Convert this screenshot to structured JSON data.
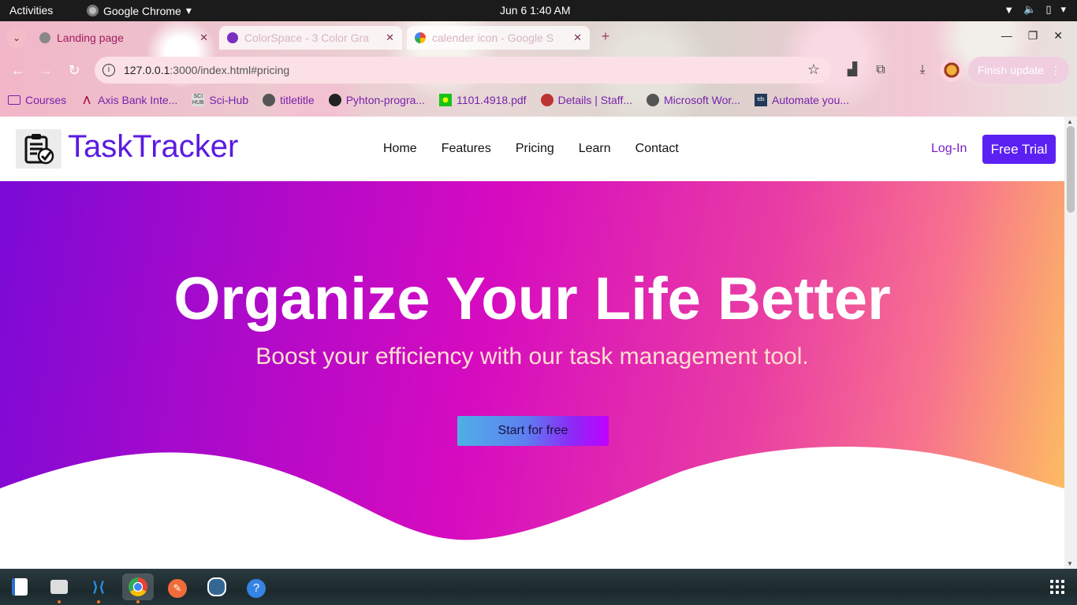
{
  "system_bar": {
    "activities": "Activities",
    "app_name": "Google Chrome",
    "clock": "Jun 6  1:40 AM"
  },
  "browser": {
    "tabs": [
      {
        "title": "Landing page",
        "active": true
      },
      {
        "title": "ColorSpace - 3 Color Gra",
        "active": false
      },
      {
        "title": "calender icon - Google S",
        "active": false
      }
    ],
    "url_host": "127.0.0.1",
    "url_rest": ":3000/index.html#pricing",
    "update_button": "Finish update",
    "bookmarks": [
      {
        "label": "Courses",
        "icon": "folder-icon"
      },
      {
        "label": "Axis Bank Inte...",
        "icon": "axis-bank-icon"
      },
      {
        "label": "Sci-Hub",
        "icon": "sci-hub-icon"
      },
      {
        "label": "titletitle",
        "icon": "globe-icon"
      },
      {
        "label": "Pyhton-progra...",
        "icon": "github-icon"
      },
      {
        "label": "1101.4918.pdf",
        "icon": "smiley-icon"
      },
      {
        "label": "Details | Staff...",
        "icon": "emblem-icon"
      },
      {
        "label": "Microsoft Wor...",
        "icon": "globe-icon"
      },
      {
        "label": "Automate you...",
        "icon": "tds-icon"
      }
    ]
  },
  "site": {
    "brand": "TaskTracker",
    "nav": [
      "Home",
      "Features",
      "Pricing",
      "Learn",
      "Contact"
    ],
    "login": "Log-In",
    "trial": "Free Trial",
    "hero_title": "Organize Your Life Better",
    "hero_subtitle": "Boost your efficiency with our task management tool.",
    "cta": "Start for free"
  },
  "colors": {
    "brand": "#5a1be0",
    "trial_button": "#5b21f2",
    "hero_gradient_start": "#7a0ad6",
    "hero_gradient_mid": "#d60bc0",
    "hero_gradient_end": "#fdc25e"
  },
  "dock": [
    "text-editor-icon",
    "files-icon",
    "vscode-icon",
    "chrome-icon",
    "postman-icon",
    "pgadmin-icon",
    "help-icon"
  ]
}
